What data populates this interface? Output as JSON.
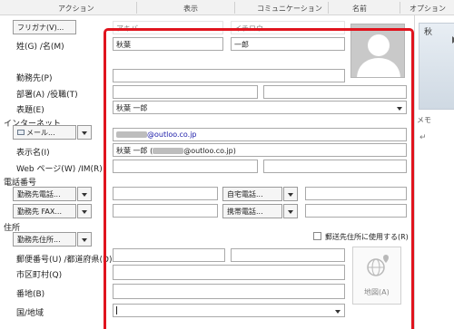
{
  "ribbon": {
    "action": "アクション",
    "display": "表示",
    "communication": "コミュニケーション",
    "name": "名前",
    "options": "オプション"
  },
  "left": {
    "furigana_button": "フリガナ(V)...",
    "name_label": "姓(G) /名(M)",
    "company_label": "勤務先(P)",
    "dept_label": "部署(A) /役職(T)",
    "display_as_label": "表題(E)",
    "internet_section": "インターネット",
    "email_button": "メール...",
    "display_name_label": "表示名(I)",
    "web_label": "Web ページ(W) /IM(R)",
    "phone_section": "電話番号",
    "phone_work_button": "勤務先電話...",
    "phone_fax_button": "勤務先 FAX...",
    "address_section": "住所",
    "address_button": "勤務先住所...",
    "postal_label": "郵便番号(U) /都道府県(D)",
    "city_label": "市区町村(Q)",
    "street_label": "番地(B)",
    "country_label": "国/地域"
  },
  "fields": {
    "last_kana_placeholder": "アキバ",
    "first_kana_placeholder": "イチロウ",
    "last_name": "秋葉",
    "first_name": "一郎",
    "company": "",
    "department": "",
    "job_title": "",
    "file_as": "秋葉 一郎",
    "email_suffix": "@outloo.co.jp",
    "display_name_prefix": "秋葉 一郎 (",
    "display_name_suffix": "@outloo.co.jp)",
    "web_page": "",
    "im_address": "",
    "phone_work": "",
    "phone_home_button": "自宅電話...",
    "phone_home": "",
    "phone_fax": "",
    "phone_mobile_button": "携帯電話...",
    "phone_mobile": "",
    "mailing_address_label": "郵送先住所に使用する(R)",
    "postal_code": "",
    "prefecture": "",
    "city": "",
    "street": "",
    "country": ""
  },
  "maps": {
    "label": "地図(A)"
  },
  "right": {
    "title": "秋",
    "memo_label": "メモ",
    "para_mark": "↵"
  }
}
